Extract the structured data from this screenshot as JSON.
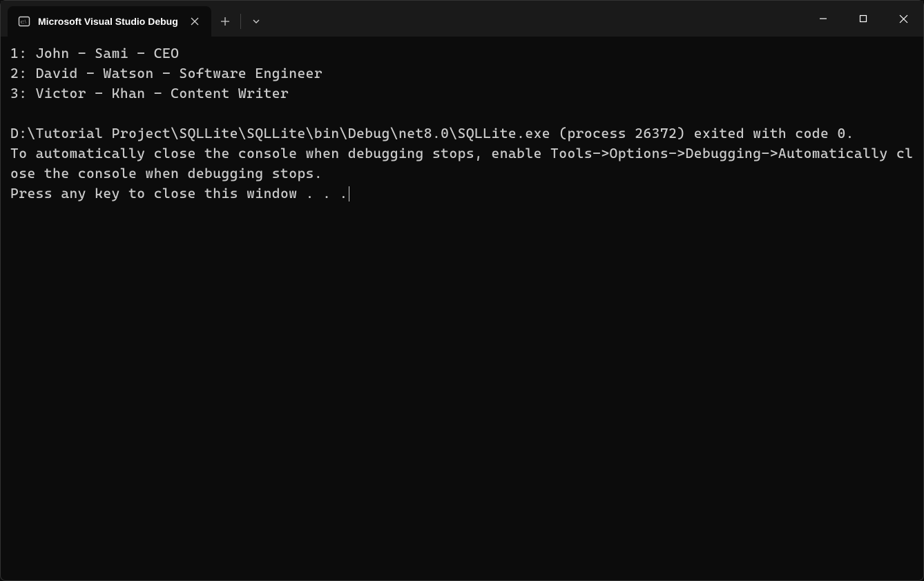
{
  "tab": {
    "title": "Microsoft Visual Studio Debug"
  },
  "console": {
    "lines": [
      "1: John - Sami - CEO",
      "2: David - Watson - Software Engineer",
      "3: Victor - Khan - Content Writer",
      "",
      "D:\\Tutorial Project\\SQLLite\\SQLLite\\bin\\Debug\\net8.0\\SQLLite.exe (process 26372) exited with code 0.",
      "To automatically close the console when debugging stops, enable Tools->Options->Debugging->Automatically close the console when debugging stops.",
      "Press any key to close this window . . ."
    ]
  }
}
